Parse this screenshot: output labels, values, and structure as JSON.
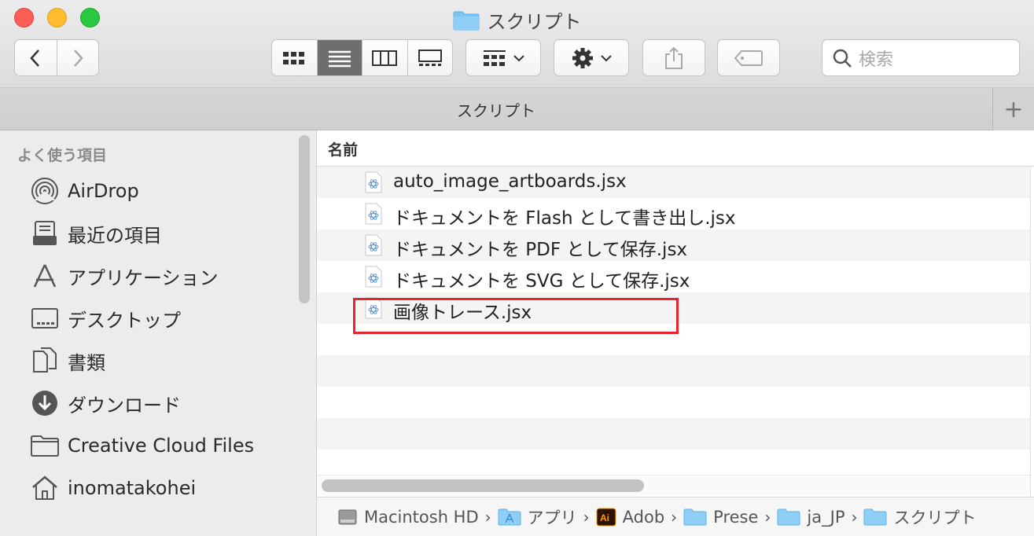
{
  "window": {
    "title": "スクリプト"
  },
  "toolbar": {
    "search_placeholder": "検索"
  },
  "tabbar": {
    "title": "スクリプト",
    "plus_label": "+"
  },
  "sidebar": {
    "heading": "よく使う項目",
    "items": [
      {
        "label": "AirDrop",
        "icon": "airdrop-icon"
      },
      {
        "label": "最近の項目",
        "icon": "recents-icon"
      },
      {
        "label": "アプリケーション",
        "icon": "applications-icon"
      },
      {
        "label": "デスクトップ",
        "icon": "desktop-icon"
      },
      {
        "label": "書類",
        "icon": "documents-icon"
      },
      {
        "label": "ダウンロード",
        "icon": "downloads-icon"
      },
      {
        "label": "Creative Cloud Files",
        "icon": "folder-icon"
      },
      {
        "label": "inomatakohei",
        "icon": "home-icon"
      }
    ]
  },
  "content": {
    "column_header": "名前",
    "files": [
      {
        "name": "auto_image_artboards.jsx",
        "highlighted": true
      },
      {
        "name": "ドキュメントを Flash として書き出し.jsx"
      },
      {
        "name": "ドキュメントを PDF として保存.jsx"
      },
      {
        "name": "ドキュメントを SVG として保存.jsx"
      },
      {
        "name": "画像トレース.jsx"
      }
    ]
  },
  "pathbar": {
    "crumbs": [
      {
        "label": "Macintosh HD",
        "icon": "harddisk-icon"
      },
      {
        "label": "アプリ",
        "icon": "applications-folder-icon"
      },
      {
        "label": "Adob",
        "icon": "illustrator-icon"
      },
      {
        "label": "Prese",
        "icon": "folder-icon"
      },
      {
        "label": "ja_JP",
        "icon": "folder-icon"
      },
      {
        "label": "スクリプト",
        "icon": "folder-icon"
      }
    ],
    "separator": "›"
  },
  "colors": {
    "accent_folder": "#5ab3ef",
    "highlight_border": "#e8232e",
    "close": "#fd5f57",
    "minimize": "#febc2e",
    "zoom": "#29c840"
  }
}
